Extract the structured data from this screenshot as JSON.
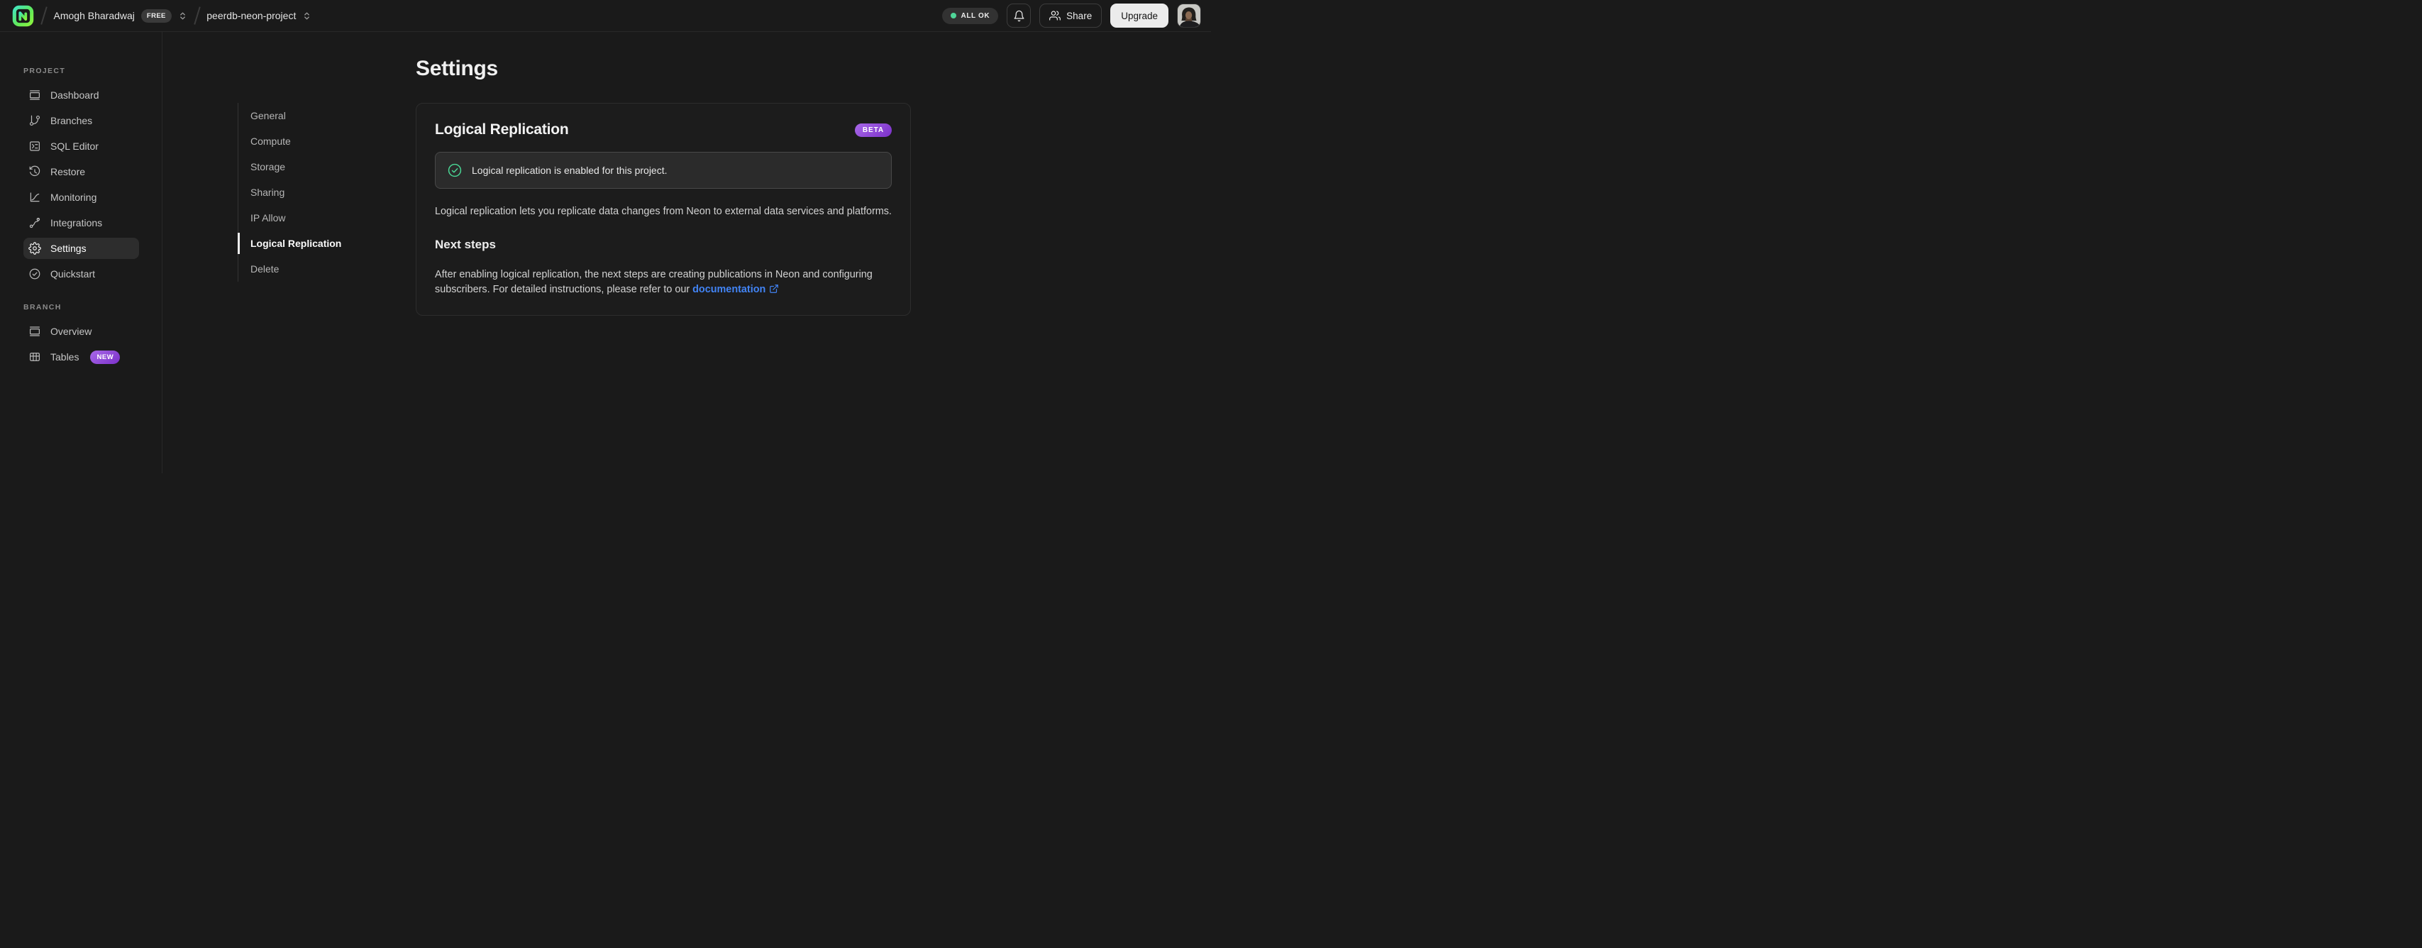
{
  "topbar": {
    "logo_icon": "neon-logo",
    "breadcrumb": {
      "org_name": "Amogh Bharadwaj",
      "org_plan_badge": "FREE",
      "project_name": "peerdb-neon-project"
    },
    "status_pill_label": "ALL OK",
    "share_label": "Share",
    "upgrade_label": "Upgrade"
  },
  "sidebar": {
    "sections": [
      {
        "label": "PROJECT",
        "items": [
          {
            "label": "Dashboard",
            "icon": "dashboard-icon"
          },
          {
            "label": "Branches",
            "icon": "git-branch-icon"
          },
          {
            "label": "SQL Editor",
            "icon": "terminal-icon"
          },
          {
            "label": "Restore",
            "icon": "history-clock-icon"
          },
          {
            "label": "Monitoring",
            "icon": "chart-curve-icon"
          },
          {
            "label": "Integrations",
            "icon": "route-icon"
          },
          {
            "label": "Settings",
            "icon": "gear-icon"
          },
          {
            "label": "Quickstart",
            "icon": "check-circle-icon"
          }
        ]
      },
      {
        "label": "BRANCH",
        "items": [
          {
            "label": "Overview",
            "icon": "window-icon"
          },
          {
            "label": "Tables",
            "icon": "table-icon",
            "badge": "NEW"
          }
        ]
      }
    ]
  },
  "main": {
    "page_title": "Settings",
    "settings_nav": {
      "items": [
        {
          "label": "General"
        },
        {
          "label": "Compute"
        },
        {
          "label": "Storage"
        },
        {
          "label": "Sharing"
        },
        {
          "label": "IP Allow"
        },
        {
          "label": "Logical Replication"
        },
        {
          "label": "Delete"
        }
      ]
    },
    "card": {
      "title": "Logical Replication",
      "badge": "BETA",
      "alert_text": "Logical replication is enabled for this project.",
      "description": "Logical replication lets you replicate data changes from Neon to external data services and platforms.",
      "next_steps_title": "Next steps",
      "next_steps_text": "After enabling logical replication, the next steps are creating publications in Neon and configuring subscribers. For detailed instructions, please refer to our ",
      "doc_link_label": "documentation"
    }
  },
  "colors": {
    "accent_green": "#4fd598",
    "badge_purple_from": "#a868e8",
    "badge_purple_to": "#7b30c9",
    "link_blue": "#4284f5",
    "background": "#1a1a1a"
  }
}
